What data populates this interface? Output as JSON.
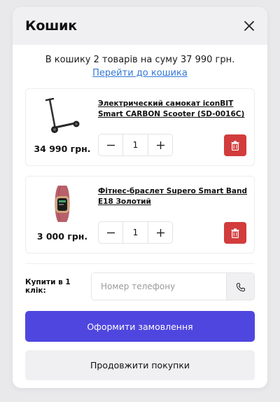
{
  "cart": {
    "title": "Кошик",
    "close_icon": "close-icon",
    "summary_text": "В кошику 2 товарів на суму 37 990 грн.",
    "go_to_cart_link": "Перейти до кошика",
    "items": [
      {
        "name": "Электрический самокат iconBIT Smart CARBON Scooter (SD-0016C)",
        "price": "34 990 грн.",
        "quantity": "1",
        "image": "scooter-image"
      },
      {
        "name": "Фітнес-браслет Supero Smart Band E18 Золотий",
        "price": "3 000 грн.",
        "quantity": "1",
        "image": "fitness-band-image"
      }
    ],
    "one_click": {
      "label": "Купити в 1 клік:",
      "phone_placeholder": "Номер телефону",
      "phone_icon": "phone-icon"
    },
    "checkout_button": "Оформити замовлення",
    "continue_button": "Продовжити покупки",
    "colors": {
      "primary": "#4f46e0",
      "delete": "#d23c3c",
      "link": "#3477d6",
      "header_bg": "#f0f0f2"
    }
  }
}
